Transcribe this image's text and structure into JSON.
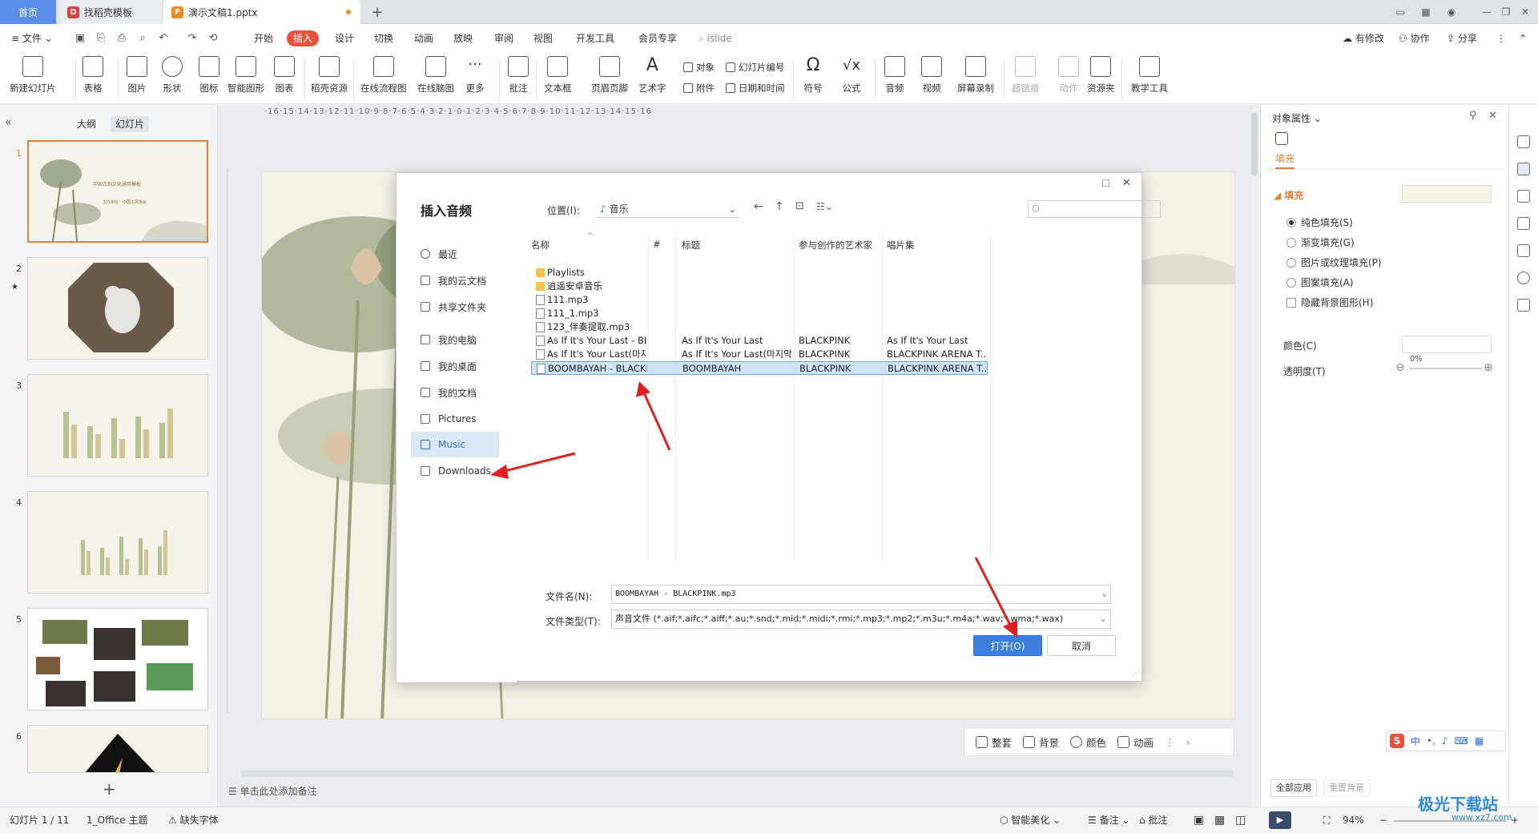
{
  "tabs": {
    "home": "首页",
    "template": "找稻壳模板",
    "document": "演示文稿1.pptx",
    "logo_letter": "P"
  },
  "menu": {
    "file": "文件",
    "items": [
      "开始",
      "插入",
      "设计",
      "切换",
      "动画",
      "放映",
      "审阅",
      "视图",
      "开发工具",
      "会员专享"
    ],
    "search": "islide",
    "right": [
      "有修改",
      "协作",
      "分享"
    ]
  },
  "ribbon": {
    "buttons": [
      "新建幻灯片",
      "表格",
      "图片",
      "形状",
      "图标",
      "智能图形",
      "图表",
      "稻壳资源",
      "在线流程图",
      "在线脑图",
      "更多",
      "批注",
      "文本框",
      "页眉页脚",
      "艺术字",
      "符号",
      "公式",
      "音频",
      "视频",
      "屏幕录制",
      "超链接",
      "动作",
      "资源夹",
      "教学工具"
    ],
    "small": [
      "对象",
      "幻灯片编号",
      "附件",
      "日期和时间"
    ]
  },
  "left_panel": {
    "tab_outline": "大纲",
    "tab_slides": "幻灯片",
    "thumb_numbers": [
      "1",
      "2",
      "3",
      "4",
      "5",
      "6"
    ],
    "thumb1_title": "中国古韵文化通用模板",
    "thumb1_sub": "主办单位：中国古风协会"
  },
  "dialog": {
    "title": "插入音频",
    "location_label": "位置(I):",
    "location_value": "音乐",
    "sidebar": [
      "最近",
      "我的云文档",
      "共享文件夹",
      "我的电脑",
      "我的桌面",
      "我的文档",
      "Pictures",
      "Music",
      "Downloads"
    ],
    "selected_sidebar": "Music",
    "columns": [
      "名称",
      "#",
      "标题",
      "参与创作的艺术家",
      "唱片集"
    ],
    "files": [
      {
        "name": "Playlists",
        "type": "folder",
        "title": "",
        "artist": "",
        "album": ""
      },
      {
        "name": "逍遥安卓音乐",
        "type": "folder",
        "title": "",
        "artist": "",
        "album": ""
      },
      {
        "name": "111.mp3",
        "type": "file",
        "title": "",
        "artist": "",
        "album": ""
      },
      {
        "name": "111_1.mp3",
        "type": "file",
        "title": "",
        "artist": "",
        "album": ""
      },
      {
        "name": "123_伴奏提取.mp3",
        "type": "file",
        "title": "",
        "artist": "",
        "album": ""
      },
      {
        "name": "As If It's Your Last - BLA...",
        "type": "file",
        "title": "As If It's Your Last",
        "artist": "BLACKPINK",
        "album": "As If It's Your Last"
      },
      {
        "name": "As If It's Your Last(마지...",
        "type": "file",
        "title": "As If It's Your Last(마지막처...",
        "artist": "BLACKPINK",
        "album": "BLACKPINK ARENA T..."
      },
      {
        "name": "BOOMBAYAH - BLACKP...",
        "type": "file",
        "title": "BOOMBAYAH",
        "artist": "BLACKPINK",
        "album": "BLACKPINK ARENA T..."
      }
    ],
    "selected_file": "BOOMBAYAH - BLACKP...",
    "filename_label": "文件名(N):",
    "filename_value": "BOOMBAYAH - BLACKPINK.mp3",
    "filetype_label": "文件类型(T):",
    "filetype_value": "声音文件 (*.aif;*.aifc;*.aiff;*.au;*.snd;*.mid;*.midi;*.rmi;*.mp3;*.mp2;*.m3u;*.m4a;*.wav;*.wma;*.wax)",
    "open_button": "打开(O)",
    "cancel_button": "取消"
  },
  "slide_toolbar": [
    "整套",
    "背景",
    "颜色",
    "动画"
  ],
  "notes_placeholder": "单击此处添加备注",
  "right_panel": {
    "title": "对象属性",
    "tab": "填充",
    "section": "填充",
    "options": [
      "纯色填充(S)",
      "渐变填充(G)",
      "图片或纹理填充(P)",
      "图案填充(A)"
    ],
    "hide_bg": "隐藏背景图形(H)",
    "color_label": "颜色(C)",
    "transparency_label": "透明度(T)",
    "transparency_value": "0%",
    "apply_all": "全部应用",
    "reset_bg": "重置背景"
  },
  "status": {
    "slide_info": "幻灯片 1 / 11",
    "theme": "1_Office 主题",
    "font_missing": "缺失字体",
    "smart": "智能美化",
    "notes": "备注",
    "comments": "批注",
    "zoom": "94%"
  },
  "ime": [
    "中"
  ],
  "watermark": "极光下载站",
  "watermark_url": "www.xz7.com",
  "colors": {
    "accent": "#3d7fe0",
    "insert_tab": "#e8513b",
    "arrow": "#e02020"
  }
}
